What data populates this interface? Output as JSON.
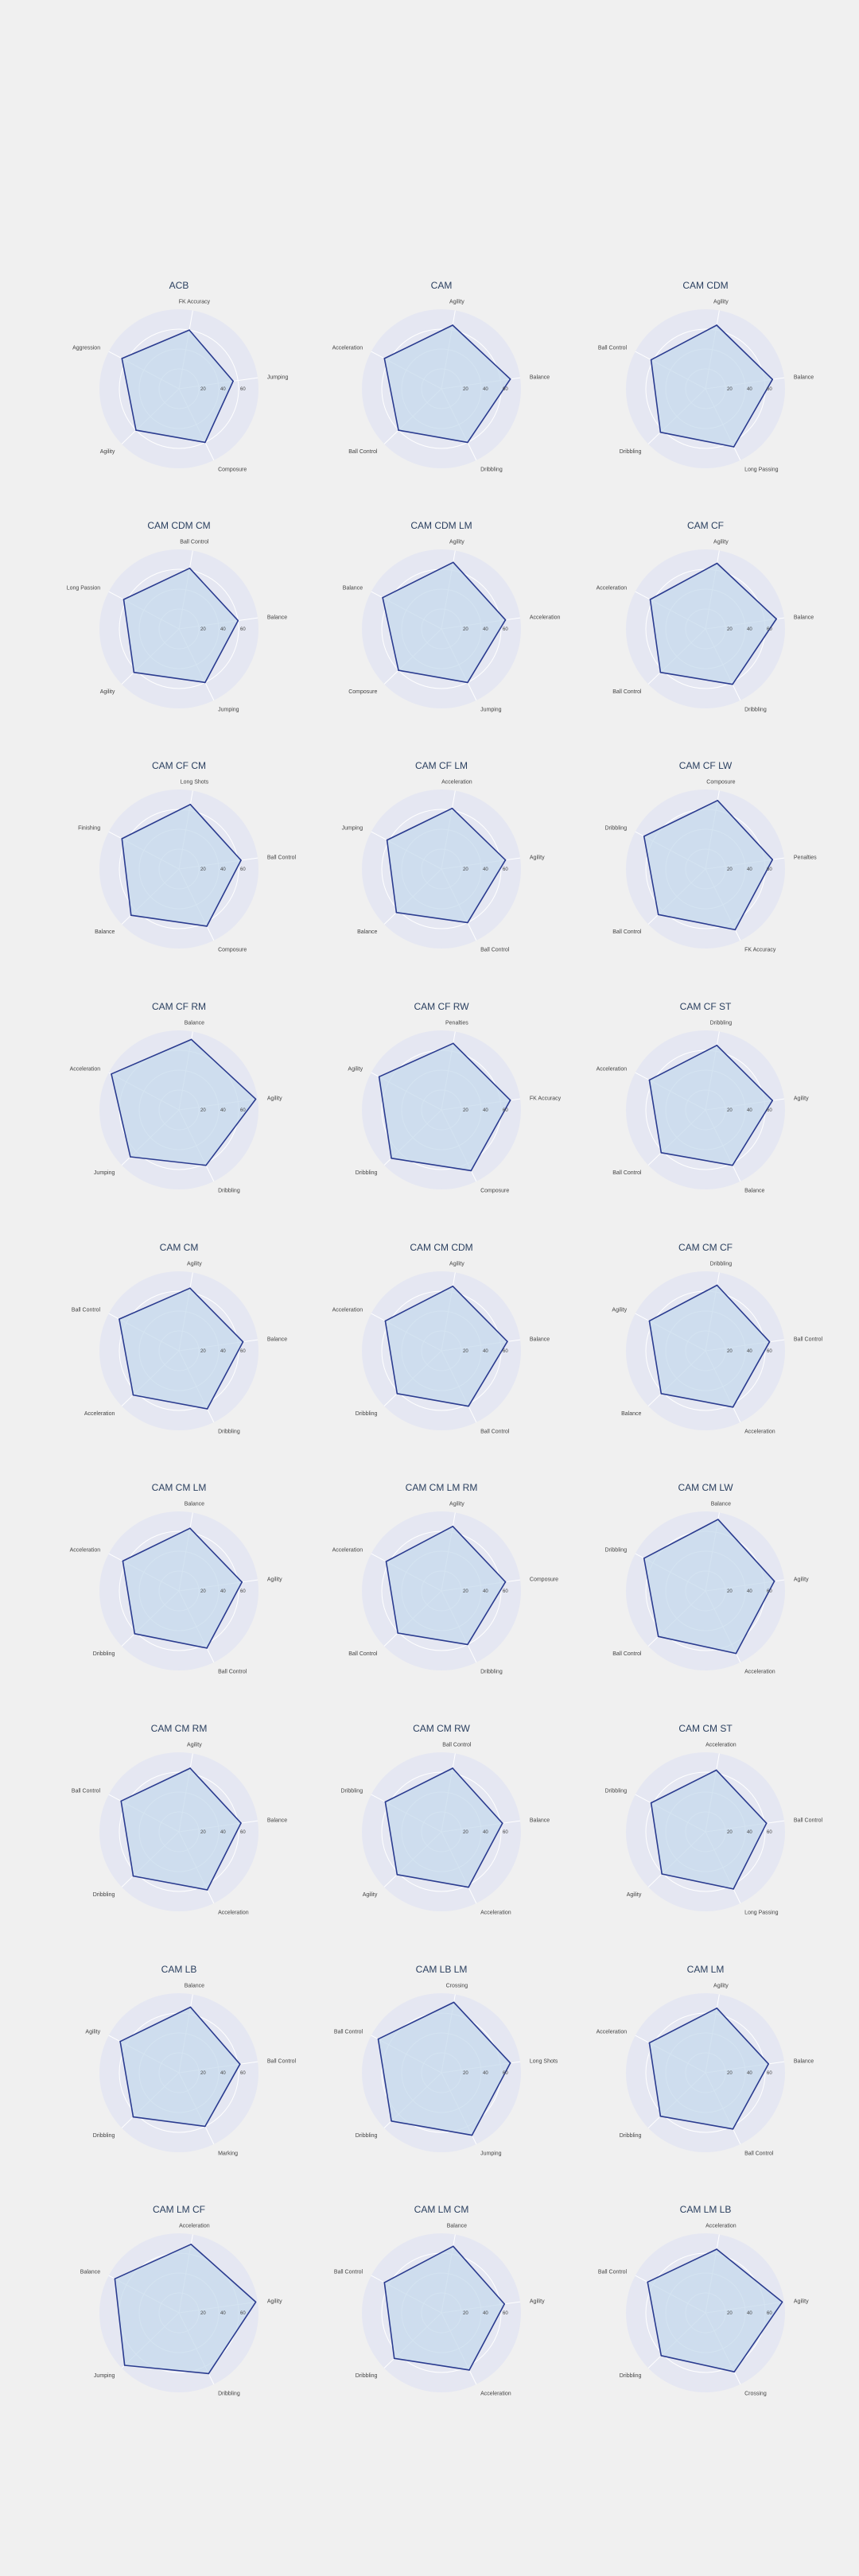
{
  "theme": {
    "background": "#f0f0f0",
    "polar_background": "#e5e7f2",
    "grid_color": "#ffffff",
    "line_color": "#2a3b8f",
    "fill_color": "#c6d9ec",
    "title_color": "#2a3f5f"
  },
  "chart_data": [
    {
      "type": "radar",
      "title": "ACB",
      "axes": [
        "FK Accuracy",
        "Jumping",
        "Composure",
        "Agility",
        "Aggression"
      ],
      "values": [
        60,
        55,
        60,
        60,
        65
      ],
      "radial_range": [
        0,
        80
      ],
      "ticks": [
        20,
        40,
        60
      ],
      "grid": true
    },
    {
      "type": "radar",
      "title": "CAM",
      "axes": [
        "Agility",
        "Balance",
        "Dribbling",
        "Ball Control",
        "Acceleration"
      ],
      "values": [
        65,
        70,
        60,
        60,
        65
      ],
      "radial_range": [
        0,
        80
      ],
      "ticks": [
        20,
        40,
        60
      ],
      "grid": true
    },
    {
      "type": "radar",
      "title": "CAM CDM",
      "axes": [
        "Agility",
        "Balance",
        "Long Passing",
        "Dribbling",
        "Ball Control"
      ],
      "values": [
        65,
        68,
        65,
        63,
        62
      ],
      "radial_range": [
        0,
        80
      ],
      "ticks": [
        20,
        40,
        60
      ],
      "grid": true
    },
    {
      "type": "radar",
      "title": "CAM CDM CM",
      "axes": [
        "Ball Control",
        "Balance",
        "Jumping",
        "Agility",
        "Long Passion"
      ],
      "values": [
        62,
        60,
        60,
        63,
        63
      ],
      "radial_range": [
        0,
        80
      ],
      "ticks": [
        20,
        40,
        60
      ],
      "grid": true
    },
    {
      "type": "radar",
      "title": "CAM CDM LM",
      "axes": [
        "Agility",
        "Acceleration",
        "Jumping",
        "Composure",
        "Balance"
      ],
      "values": [
        68,
        65,
        60,
        60,
        67
      ],
      "radial_range": [
        0,
        80
      ],
      "ticks": [
        20,
        40,
        60
      ],
      "grid": true
    },
    {
      "type": "radar",
      "title": "CAM CF",
      "axes": [
        "Agility",
        "Balance",
        "Dribbling",
        "Ball Control",
        "Acceleration"
      ],
      "values": [
        67,
        72,
        62,
        63,
        63
      ],
      "radial_range": [
        0,
        80
      ],
      "ticks": [
        20,
        40,
        60
      ],
      "grid": true
    },
    {
      "type": "radar",
      "title": "CAM CF CM",
      "axes": [
        "Long Shots",
        "Ball Control",
        "Composure",
        "Balance",
        "Finishing"
      ],
      "values": [
        66,
        63,
        64,
        67,
        65
      ],
      "radial_range": [
        0,
        80
      ],
      "ticks": [
        20,
        40,
        60
      ],
      "grid": true
    },
    {
      "type": "radar",
      "title": "CAM CF LM",
      "axes": [
        "Acceleration",
        "Agility",
        "Ball Control",
        "Balance",
        "Jumping"
      ],
      "values": [
        62,
        65,
        60,
        63,
        62
      ],
      "radial_range": [
        0,
        80
      ],
      "ticks": [
        20,
        40,
        60
      ],
      "grid": true
    },
    {
      "type": "radar",
      "title": "CAM CF LW",
      "axes": [
        "Composure",
        "Penalties",
        "FK Accuracy",
        "Ball Control",
        "Dribbling"
      ],
      "values": [
        70,
        68,
        68,
        66,
        70
      ],
      "radial_range": [
        0,
        80
      ],
      "ticks": [
        20,
        40,
        60
      ],
      "grid": true
    },
    {
      "type": "radar",
      "title": "CAM CF RM",
      "axes": [
        "Balance",
        "Agility",
        "Dribbling",
        "Jumping",
        "Acceleration"
      ],
      "values": [
        72,
        78,
        62,
        68,
        77
      ],
      "radial_range": [
        0,
        80
      ],
      "ticks": [
        20,
        40,
        60
      ],
      "grid": true
    },
    {
      "type": "radar",
      "title": "CAM CF RW",
      "axes": [
        "Penalties",
        "FK Accuracy",
        "Composure",
        "Dribbling",
        "Agility"
      ],
      "values": [
        68,
        70,
        68,
        70,
        71
      ],
      "radial_range": [
        0,
        80
      ],
      "ticks": [
        20,
        40,
        60
      ],
      "grid": true
    },
    {
      "type": "radar",
      "title": "CAM CF ST",
      "axes": [
        "Dribbling",
        "Agility",
        "Balance",
        "Ball Control",
        "Acceleration"
      ],
      "values": [
        66,
        68,
        62,
        62,
        64
      ],
      "radial_range": [
        0,
        80
      ],
      "ticks": [
        20,
        40,
        60
      ],
      "grid": true
    },
    {
      "type": "radar",
      "title": "CAM CM",
      "axes": [
        "Agility",
        "Balance",
        "Dribbling",
        "Acceleration",
        "Ball Control"
      ],
      "values": [
        64,
        65,
        65,
        64,
        68
      ],
      "radial_range": [
        0,
        80
      ],
      "ticks": [
        20,
        40,
        60
      ],
      "grid": true
    },
    {
      "type": "radar",
      "title": "CAM CM CDM",
      "axes": [
        "Agility",
        "Balance",
        "Ball Control",
        "Dribbling",
        "Acceleration"
      ],
      "values": [
        66,
        67,
        62,
        62,
        64
      ],
      "radial_range": [
        0,
        80
      ],
      "ticks": [
        20,
        40,
        60
      ],
      "grid": true
    },
    {
      "type": "radar",
      "title": "CAM CM CF",
      "axes": [
        "Dribbling",
        "Ball Control",
        "Acceleration",
        "Balance",
        "Agility"
      ],
      "values": [
        67,
        65,
        63,
        62,
        64
      ],
      "radial_range": [
        0,
        80
      ],
      "ticks": [
        20,
        40,
        60
      ],
      "grid": true
    },
    {
      "type": "radar",
      "title": "CAM CM LM",
      "axes": [
        "Balance",
        "Agility",
        "Ball Control",
        "Dribbling",
        "Acceleration"
      ],
      "values": [
        64,
        64,
        64,
        62,
        64
      ],
      "radial_range": [
        0,
        80
      ],
      "ticks": [
        20,
        40,
        60
      ],
      "grid": true
    },
    {
      "type": "radar",
      "title": "CAM CM LM RM",
      "axes": [
        "Agility",
        "Composure",
        "Dribbling",
        "Ball Control",
        "Acceleration"
      ],
      "values": [
        66,
        65,
        60,
        61,
        63
      ],
      "radial_range": [
        0,
        80
      ],
      "ticks": [
        20,
        40,
        60
      ],
      "grid": true
    },
    {
      "type": "radar",
      "title": "CAM CM LW",
      "axes": [
        "Balance",
        "Agility",
        "Acceleration",
        "Ball Control",
        "Dribbling"
      ],
      "values": [
        73,
        70,
        70,
        66,
        70
      ],
      "radial_range": [
        0,
        80
      ],
      "ticks": [
        20,
        40,
        60
      ],
      "grid": true
    },
    {
      "type": "radar",
      "title": "CAM CM RM",
      "axes": [
        "Agility",
        "Balance",
        "Acceleration",
        "Dribbling",
        "Ball Control"
      ],
      "values": [
        65,
        63,
        65,
        64,
        66
      ],
      "radial_range": [
        0,
        80
      ],
      "ticks": [
        20,
        40,
        60
      ],
      "grid": true
    },
    {
      "type": "radar",
      "title": "CAM CM RW",
      "axes": [
        "Ball Control",
        "Balance",
        "Acceleration",
        "Agility",
        "Dribbling"
      ],
      "values": [
        65,
        62,
        62,
        62,
        64
      ],
      "radial_range": [
        0,
        80
      ],
      "ticks": [
        20,
        40,
        60
      ],
      "grid": true
    },
    {
      "type": "radar",
      "title": "CAM CM ST",
      "axes": [
        "Acceleration",
        "Ball Control",
        "Long Passing",
        "Agility",
        "Dribbling"
      ],
      "values": [
        63,
        62,
        64,
        61,
        62
      ],
      "radial_range": [
        0,
        80
      ],
      "ticks": [
        20,
        40,
        60
      ],
      "grid": true
    },
    {
      "type": "radar",
      "title": "CAM LB",
      "axes": [
        "Balance",
        "Ball Control",
        "Marking",
        "Dribbling",
        "Agility"
      ],
      "values": [
        67,
        62,
        60,
        64,
        67
      ],
      "radial_range": [
        0,
        80
      ],
      "ticks": [
        20,
        40,
        60
      ],
      "grid": true
    },
    {
      "type": "radar",
      "title": "CAM LB LM",
      "axes": [
        "Crossing",
        "Long Shots",
        "Jumping",
        "Dribbling",
        "Ball Control"
      ],
      "values": [
        72,
        70,
        70,
        70,
        72
      ],
      "radial_range": [
        0,
        80
      ],
      "ticks": [
        20,
        40,
        60
      ],
      "grid": true
    },
    {
      "type": "radar",
      "title": "CAM LM",
      "axes": [
        "Agility",
        "Balance",
        "Ball Control",
        "Dribbling",
        "Acceleration"
      ],
      "values": [
        66,
        64,
        63,
        63,
        64
      ],
      "radial_range": [
        0,
        80
      ],
      "ticks": [
        20,
        40,
        60
      ],
      "grid": true
    },
    {
      "type": "radar",
      "title": "CAM LM CF",
      "axes": [
        "Acceleration",
        "Agility",
        "Dribbling",
        "Jumping",
        "Balance"
      ],
      "values": [
        70,
        78,
        68,
        76,
        73
      ],
      "radial_range": [
        0,
        80
      ],
      "ticks": [
        20,
        40,
        60
      ],
      "grid": true
    },
    {
      "type": "radar",
      "title": "CAM LM CM",
      "axes": [
        "Balance",
        "Agility",
        "Acceleration",
        "Dribbling",
        "Ball Control"
      ],
      "values": [
        68,
        64,
        64,
        66,
        65
      ],
      "radial_range": [
        0,
        80
      ],
      "ticks": [
        20,
        40,
        60
      ],
      "grid": true
    },
    {
      "type": "radar",
      "title": "CAM LM LB",
      "axes": [
        "Acceleration",
        "Agility",
        "Crossing",
        "Dribbling",
        "Ball Control"
      ],
      "values": [
        65,
        78,
        66,
        62,
        66
      ],
      "radial_range": [
        0,
        80
      ],
      "ticks": [
        20,
        40,
        60
      ],
      "grid": true
    }
  ]
}
